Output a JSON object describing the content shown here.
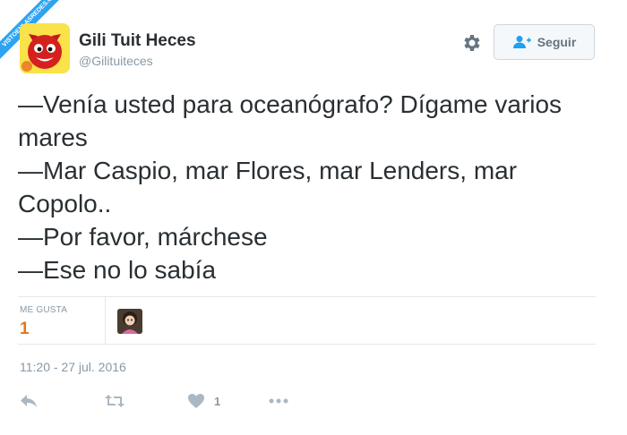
{
  "user": {
    "display_name": "Gili Tuit Heces",
    "handle": "@Gilituiteces",
    "avatar_icon": "devil-avatar"
  },
  "header": {
    "settings_icon": "gear-icon",
    "follow_label": "Seguir",
    "follow_icon": "person-add-icon"
  },
  "tweet": {
    "lines": [
      "—Venía usted para oceanógrafo? Dígame varios",
      "mares",
      "—Mar Caspio, mar Flores, mar Lenders, mar",
      "Copolo..",
      "—Por favor, márchese",
      "—Ese no lo sabía"
    ]
  },
  "stats": {
    "likes_label": "ME GUSTA",
    "likes_count": "1",
    "liker_icon": "liker-avatar"
  },
  "timestamp": "11:20 - 27 jul. 2016",
  "actions": {
    "reply_icon": "reply-icon",
    "retweet_icon": "retweet-icon",
    "like_icon": "heart-icon",
    "like_count": "1",
    "more_icon": "more-icon"
  },
  "watermark": {
    "text": "VISTOENLASREDES.COM"
  },
  "colors": {
    "text": "#292f33",
    "muted": "#8899a6",
    "likes_accent": "#e0791d",
    "border": "#e1e8ed"
  }
}
